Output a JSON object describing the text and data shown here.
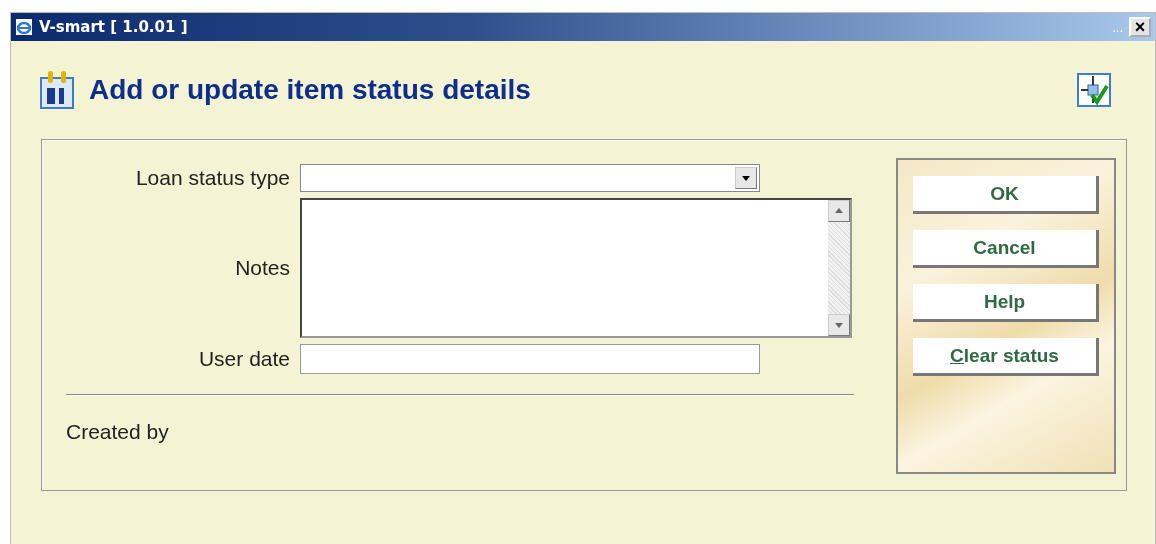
{
  "window": {
    "title": "V-smart [ 1.0.01 ]",
    "menu_dots": "...",
    "close": "×"
  },
  "page": {
    "title": "Add or update item status details"
  },
  "form": {
    "loan_status_type": {
      "label": "Loan status type"
    },
    "notes": {
      "label": "Notes"
    },
    "user_date": {
      "label": "User date"
    },
    "created_by": {
      "label": "Created by"
    }
  },
  "buttons": [
    "OK",
    "Cancel",
    "Help",
    "Clear status"
  ]
}
